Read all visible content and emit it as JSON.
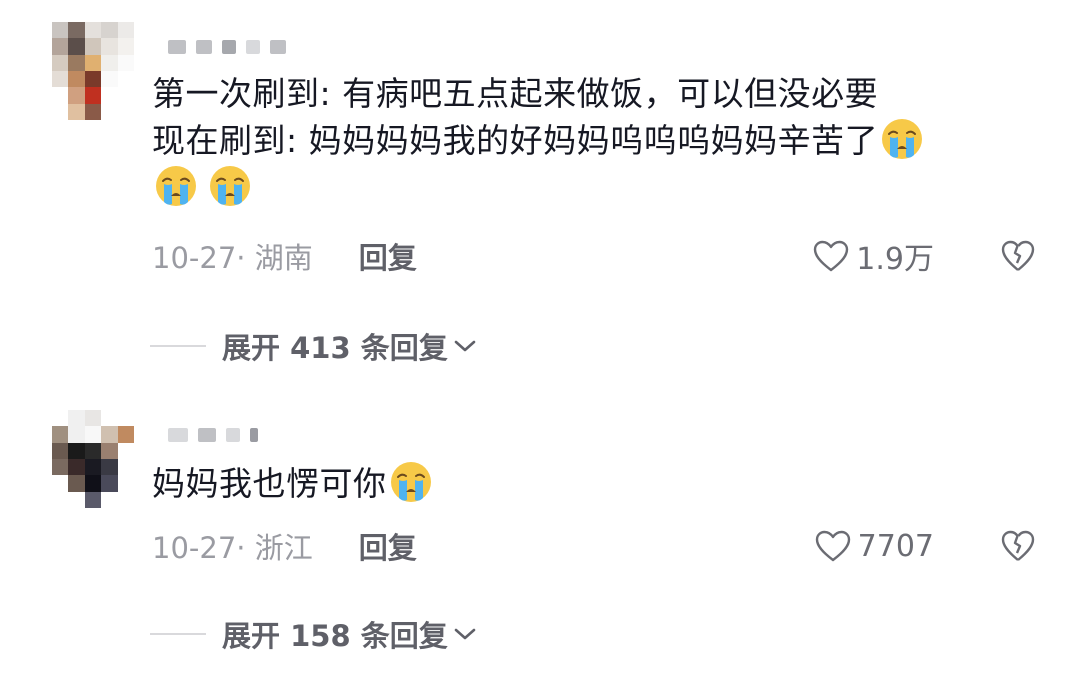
{
  "comments": [
    {
      "text_line1": "第一次刷到: 有病吧五点起来做饭，可以但没必要",
      "text_line2": "现在刷到: 妈妈妈妈我的好妈妈呜呜呜妈妈辛苦了",
      "emoji": "crying-face-emoji",
      "date_location": "10-27· 湖南",
      "reply_label": "回复",
      "likes": "1.9万",
      "expand_label": "展开 413 条回复"
    },
    {
      "text_line1": "妈妈我也愣可你",
      "emoji": "crying-face-emoji",
      "date_location": "10-27· 浙江",
      "reply_label": "回复",
      "likes": "7707",
      "expand_label": "展开 158 条回复"
    }
  ],
  "colors": {
    "text": "#161823",
    "meta": "#9a9ba2",
    "reply": "#5f6068",
    "emoji_face": "#f7c948",
    "emoji_tears": "#4fb3f0"
  },
  "icons": [
    "heart-outline-icon",
    "broken-heart-icon",
    "chevron-down-icon"
  ]
}
